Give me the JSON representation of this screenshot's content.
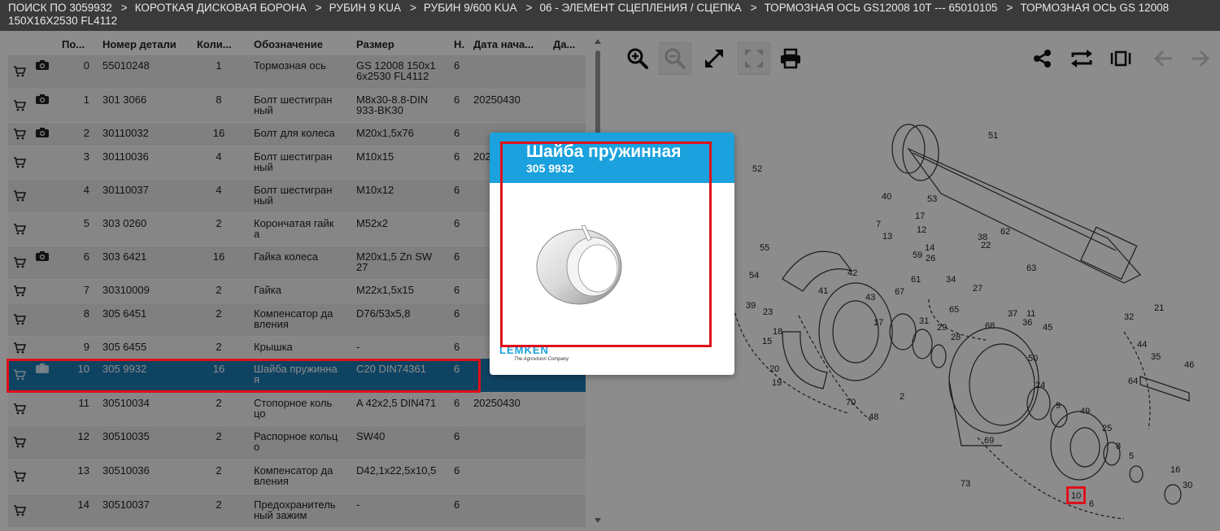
{
  "breadcrumb": [
    "ПОИСК ПО 3059932",
    "КОРОТКАЯ ДИСКОВАЯ БОРОНА",
    "РУБИН 9 KUA",
    "РУБИН 9/600 KUA",
    "06 - ЭЛЕМЕНТ СЦЕПЛЕНИЯ / СЦЕПКА",
    "ТОРМОЗНАЯ ОСЬ GS12008 10T --- 65010105",
    "ТОРМОЗНАЯ ОСЬ GS 12008",
    "150X16X2530 FL4112"
  ],
  "breadcrumb_sep": ">",
  "table": {
    "headers": {
      "pos": "По...",
      "part": "Номер детали",
      "qty": "Коли...",
      "name": "Обозначение",
      "size": "Размер",
      "n": "Н.",
      "date_start": "Дата нача...",
      "date_end": "Да..."
    },
    "rows": [
      {
        "pos": "0",
        "part": "55010248",
        "qty": "1",
        "name1": "Тормозная ось",
        "name2": "",
        "size1": "GS 12008 150x1",
        "size2": "6x2530 FL4112",
        "n": "6",
        "date": "",
        "camera": true
      },
      {
        "pos": "1",
        "part": "301 3066",
        "qty": "8",
        "name1": "Болт шестигран",
        "name2": "ный",
        "size1": "M8x30-8.8-DIN",
        "size2": "933-BK30",
        "n": "6",
        "date": "20250430",
        "camera": true
      },
      {
        "pos": "2",
        "part": "30110032",
        "qty": "16",
        "name1": "Болт для колеса",
        "name2": "",
        "size1": "M20x1,5x76",
        "size2": "",
        "n": "6",
        "date": "",
        "camera": true
      },
      {
        "pos": "3",
        "part": "30110036",
        "qty": "4",
        "name1": "Болт шестигран",
        "name2": "ный",
        "size1": "M10x15",
        "size2": "",
        "n": "6",
        "date": "202",
        "camera": false
      },
      {
        "pos": "4",
        "part": "30110037",
        "qty": "4",
        "name1": "Болт шестигран",
        "name2": "ный",
        "size1": "M10x12",
        "size2": "",
        "n": "6",
        "date": "",
        "camera": false
      },
      {
        "pos": "5",
        "part": "303 0260",
        "qty": "2",
        "name1": "Корончатая гайк",
        "name2": "а",
        "size1": "M52x2",
        "size2": "",
        "n": "6",
        "date": "",
        "camera": false
      },
      {
        "pos": "6",
        "part": "303 6421",
        "qty": "16",
        "name1": "Гайка колеса",
        "name2": "",
        "size1": "M20x1,5 Zn SW",
        "size2": "27",
        "n": "6",
        "date": "",
        "camera": true
      },
      {
        "pos": "7",
        "part": "30310009",
        "qty": "2",
        "name1": "Гайка",
        "name2": "",
        "size1": "M22x1,5x15",
        "size2": "",
        "n": "6",
        "date": "",
        "camera": false
      },
      {
        "pos": "8",
        "part": "305 6451",
        "qty": "2",
        "name1": "Компенсатор да",
        "name2": "вления",
        "size1": "D76/53x5,8",
        "size2": "",
        "n": "6",
        "date": "",
        "camera": false
      },
      {
        "pos": "9",
        "part": "305 6455",
        "qty": "2",
        "name1": "Крышка",
        "name2": "",
        "size1": "-",
        "size2": "",
        "n": "6",
        "date": "",
        "camera": false
      },
      {
        "pos": "10",
        "part": "305 9932",
        "qty": "16",
        "name1": "Шайба пружинна",
        "name2": "я",
        "size1": "C20 DIN74361",
        "size2": "",
        "n": "6",
        "date": "",
        "camera": true,
        "selected": true
      },
      {
        "pos": "11",
        "part": "30510034",
        "qty": "2",
        "name1": "Стопорное коль",
        "name2": "цо",
        "size1": "A 42x2,5 DIN471",
        "size2": "",
        "n": "6",
        "date": "20250430",
        "camera": false
      },
      {
        "pos": "12",
        "part": "30510035",
        "qty": "2",
        "name1": "Распорное кольц",
        "name2": "о",
        "size1": "SW40",
        "size2": "",
        "n": "6",
        "date": "",
        "camera": false
      },
      {
        "pos": "13",
        "part": "30510036",
        "qty": "2",
        "name1": "Компенсатор да",
        "name2": "вления",
        "size1": "D42,1x22,5x10,5",
        "size2": "",
        "n": "6",
        "date": "",
        "camera": false
      },
      {
        "pos": "14",
        "part": "30510037",
        "qty": "2",
        "name1": "Предохранитель",
        "name2": "ный зажим",
        "size1": "-",
        "size2": "",
        "n": "6",
        "date": "",
        "camera": false
      }
    ]
  },
  "popup": {
    "title": "Шайба пружинная",
    "part_number": "305 9932",
    "logo": "LEMKEN",
    "logo_tagline": "The Agrovision Company"
  },
  "diagram": {
    "labels": [
      "51",
      "52",
      "53",
      "40",
      "7",
      "17",
      "13",
      "12",
      "14",
      "55",
      "38",
      "22",
      "59",
      "26",
      "62",
      "61",
      "34",
      "27",
      "63",
      "42",
      "41",
      "43",
      "54",
      "39",
      "67",
      "65",
      "11",
      "37",
      "36",
      "45",
      "32",
      "21",
      "23",
      "17",
      "18",
      "15",
      "31",
      "29",
      "28",
      "68",
      "44",
      "35",
      "46",
      "20",
      "19",
      "50",
      "24",
      "9",
      "70",
      "2",
      "48",
      "69",
      "49",
      "25",
      "8",
      "5",
      "64",
      "16",
      "73",
      "10",
      "6",
      "30"
    ],
    "highlighted_label": "10"
  },
  "colors": {
    "accent": "#1aa1de",
    "selected_row": "#1c7bb3",
    "highlight": "#e0101a",
    "header_bar": "#3a3a3a"
  }
}
